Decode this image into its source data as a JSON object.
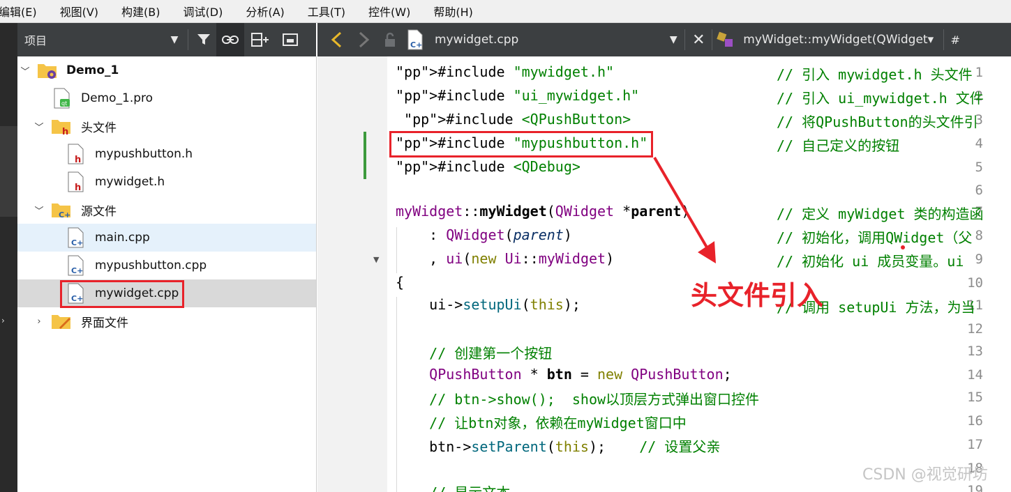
{
  "menu": [
    "编辑(E)",
    "视图(V)",
    "构建(B)",
    "调试(D)",
    "分析(A)",
    "工具(T)",
    "控件(W)",
    "帮助(H)"
  ],
  "project_panel": {
    "title": "项目",
    "tree": [
      {
        "label": "Demo_1",
        "level": 0,
        "icon": "project-icon",
        "expanded": true,
        "bold": true
      },
      {
        "label": "Demo_1.pro",
        "level": 1,
        "icon": "pro-file-icon"
      },
      {
        "label": "头文件",
        "level": 1,
        "icon": "header-folder-icon",
        "expanded": true
      },
      {
        "label": "mypushbutton.h",
        "level": 2,
        "icon": "header-file-icon"
      },
      {
        "label": "mywidget.h",
        "level": 2,
        "icon": "header-file-icon"
      },
      {
        "label": "源文件",
        "level": 1,
        "icon": "source-folder-icon",
        "expanded": true
      },
      {
        "label": "main.cpp",
        "level": 2,
        "icon": "cpp-file-icon"
      },
      {
        "label": "mypushbutton.cpp",
        "level": 2,
        "icon": "cpp-file-icon"
      },
      {
        "label": "mywidget.cpp",
        "level": 2,
        "icon": "cpp-file-icon",
        "selected": true
      },
      {
        "label": "界面文件",
        "level": 1,
        "icon": "form-folder-icon",
        "expanded": false
      }
    ]
  },
  "editor_toolbar": {
    "file_name": "mywidget.cpp",
    "function": "myWidget::myWidget(QWidget▾",
    "hash": "#"
  },
  "code_lines": [
    {
      "n": "1",
      "text": "#include \"mywidget.h\"",
      "comment": "// 引入 mywidget.h 头文件"
    },
    {
      "n": "2",
      "text": "#include \"ui_mywidget.h\"",
      "comment": "// 引入 ui_mywidget.h 文件"
    },
    {
      "n": "3",
      "text": " #include <QPushButton>",
      "comment": "// 将QPushButton的头文件引"
    },
    {
      "n": "4",
      "text": "#include \"mypushbutton.h\"",
      "comment": "// 自己定义的按钮"
    },
    {
      "n": "5",
      "text": "#include <QDebug>",
      "comment": ""
    },
    {
      "n": "6",
      "text": "",
      "comment": ""
    },
    {
      "n": "7",
      "text": "myWidget::myWidget(QWidget *parent)",
      "comment": "// 定义 myWidget 类的构造函"
    },
    {
      "n": "8",
      "text": "    : QWidget(parent)",
      "comment": "// 初始化，调用QWidget（父"
    },
    {
      "n": "9",
      "text": "    , ui(new Ui::myWidget)",
      "comment": "// 初始化 ui 成员变量。ui"
    },
    {
      "n": "10",
      "text": "{",
      "comment": ""
    },
    {
      "n": "11",
      "text": "    ui->setupUi(this);",
      "comment": "// 调用 setupUi 方法，为当"
    },
    {
      "n": "12",
      "text": "",
      "comment": ""
    },
    {
      "n": "13",
      "text": "    // 创建第一个按钮",
      "comment": ""
    },
    {
      "n": "14",
      "text": "    QPushButton * btn = new QPushButton;",
      "comment": ""
    },
    {
      "n": "15",
      "text": "    // btn->show();  show以顶层方式弹出窗口控件",
      "comment": ""
    },
    {
      "n": "16",
      "text": "    // 让btn对象，依赖在myWidget窗口中",
      "comment": ""
    },
    {
      "n": "17",
      "text": "    btn->setParent(this);    // 设置父亲",
      "comment": ""
    },
    {
      "n": "18",
      "text": "",
      "comment": ""
    },
    {
      "n": "19",
      "text": "    // 显示文本",
      "comment": ""
    }
  ],
  "annotation": "头文件引入",
  "watermark": "CSDN @视觉研坊",
  "colors": {
    "highlight": "#e8222a",
    "toolbar": "#3c3f41",
    "selected_row": "#d9d9d9"
  }
}
